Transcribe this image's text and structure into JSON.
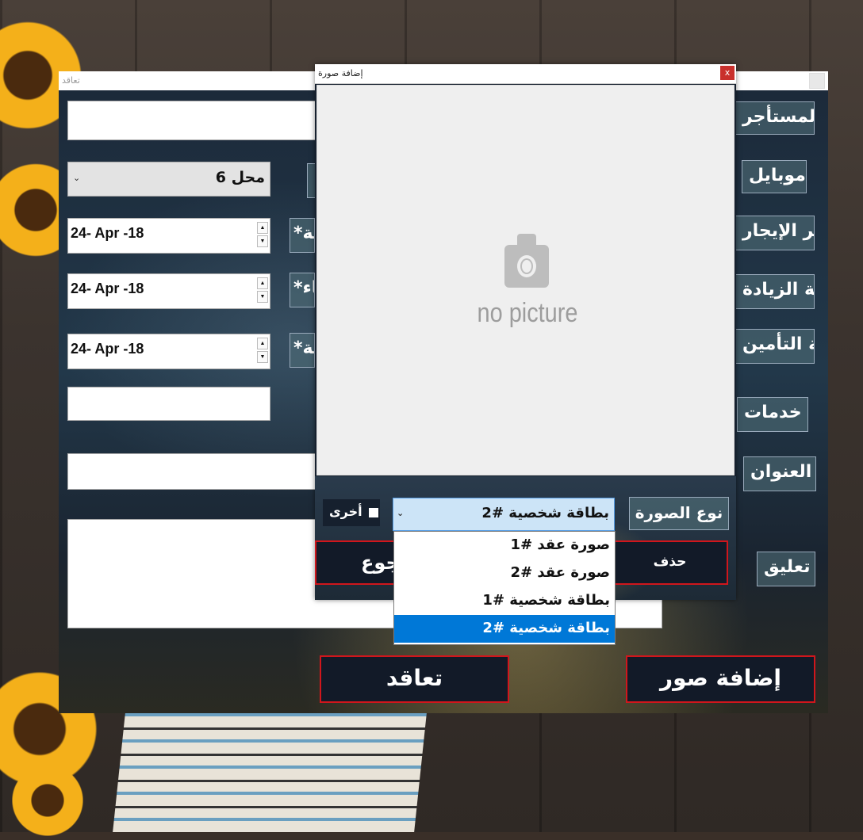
{
  "main_window": {
    "title": "تعاقد",
    "store_combo_value": "محل 6",
    "dates": [
      "24- Apr -18",
      "24- Apr -18",
      "24- Apr -18"
    ],
    "labels": {
      "tenant_name": "اسم المستأجر",
      "mobile": "موبايل",
      "rent_price": "سعر الإيجار",
      "increase_rate": "نسبة الزيادة",
      "insurance_value": "قيمة التأمين",
      "services": "خدمات",
      "address": "العنوان",
      "comment": "تعليق",
      "date_label_1": "*تاريخ البداية",
      "date_label_2": "*تاريخ الانتهاء",
      "date_label_3": "*تاريخ الدفعة"
    },
    "contract_button": "تعاقد",
    "add_images_button": "إضافة صور"
  },
  "dialog": {
    "title": "إضافة صورة",
    "close_label": "x",
    "no_picture_text": "no picture",
    "other_checkbox_label": "أخرى",
    "image_type_label": "نوع الصورة",
    "image_type_value": "بطاقة شخصية #2",
    "image_type_options": [
      "صورة عقد #1",
      "صورة عقد #2",
      "بطاقة شخصية #1",
      "بطاقة شخصية #2"
    ],
    "back_button": "رجوع",
    "delete_button": "حذف"
  },
  "colors": {
    "accent_border": "#d0161c",
    "selection": "#0078d7"
  }
}
